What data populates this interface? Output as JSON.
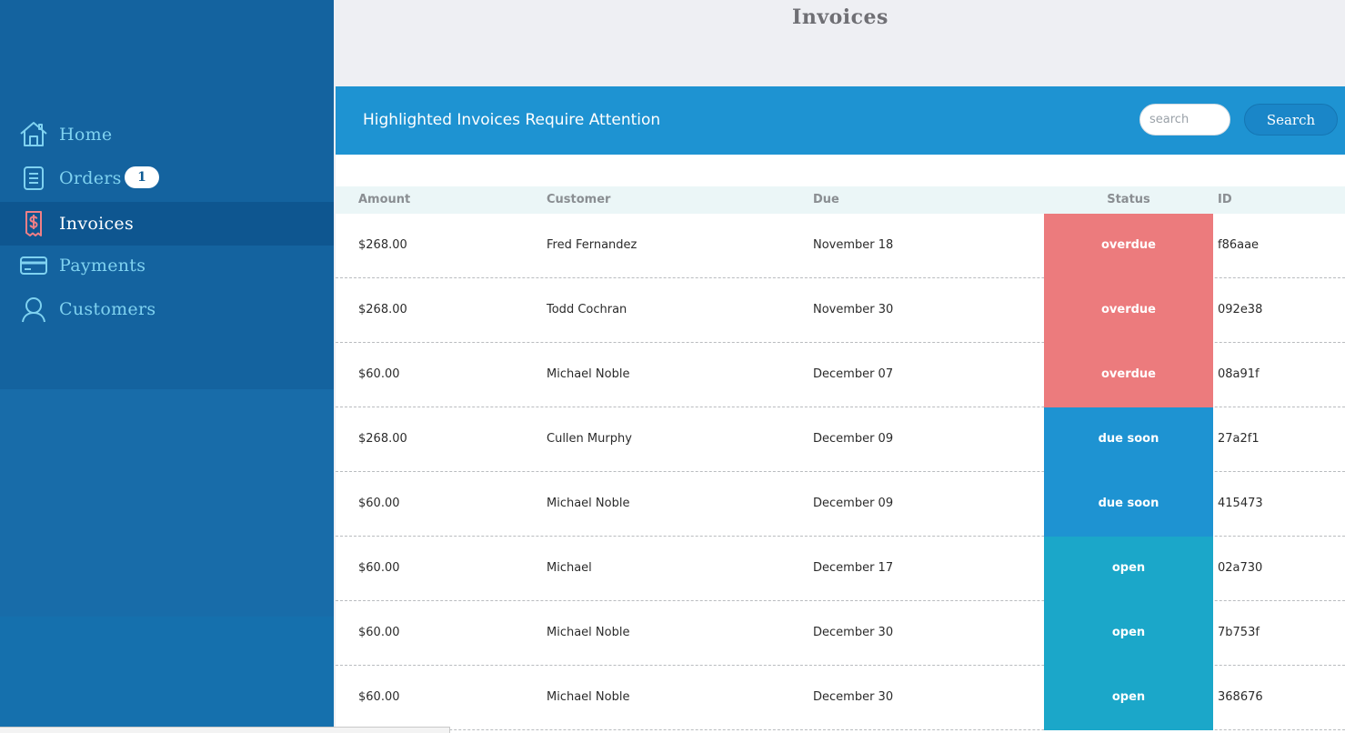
{
  "sidebar": {
    "items": [
      {
        "label": "Home",
        "icon": "home-icon"
      },
      {
        "label": "Orders",
        "icon": "orders-icon",
        "badge": "1"
      },
      {
        "label": "Invoices",
        "icon": "invoice-dollar-icon",
        "active": true
      },
      {
        "label": "Payments",
        "icon": "credit-card-icon"
      },
      {
        "label": "Customers",
        "icon": "user-icon"
      }
    ]
  },
  "header": {
    "title": "Invoices"
  },
  "banner": {
    "text": "Highlighted Invoices Require Attention",
    "search_placeholder": "search",
    "search_button": "Search"
  },
  "table": {
    "columns": [
      "Amount",
      "Customer",
      "Due",
      "Status",
      "ID"
    ],
    "rows": [
      {
        "amount": "$268.00",
        "customer": "Fred Fernandez",
        "due": "November 18",
        "status": "overdue",
        "id": "f86aae"
      },
      {
        "amount": "$268.00",
        "customer": "Todd Cochran",
        "due": "November 30",
        "status": "overdue",
        "id": "092e38"
      },
      {
        "amount": "$60.00",
        "customer": "Michael Noble",
        "due": "December 07",
        "status": "overdue",
        "id": "08a91f"
      },
      {
        "amount": "$268.00",
        "customer": "Cullen Murphy",
        "due": "December 09",
        "status": "due soon",
        "id": "27a2f1"
      },
      {
        "amount": "$60.00",
        "customer": "Michael Noble",
        "due": "December 09",
        "status": "due soon",
        "id": "415473"
      },
      {
        "amount": "$60.00",
        "customer": "Michael",
        "due": "December 17",
        "status": "open",
        "id": "02a730"
      },
      {
        "amount": "$60.00",
        "customer": "Michael Noble",
        "due": "December 30",
        "status": "open",
        "id": "7b753f"
      },
      {
        "amount": "$60.00",
        "customer": "Michael Noble",
        "due": "December 30",
        "status": "open",
        "id": "368676"
      }
    ]
  },
  "colors": {
    "sidebar": "#14639f",
    "sidebar_active": "#0e5690",
    "nav_text": "#7fd2f0",
    "banner": "#1e93d2",
    "overdue": "#ec7b7d",
    "due_soon": "#1e93d2",
    "open": "#1ba7c9"
  }
}
